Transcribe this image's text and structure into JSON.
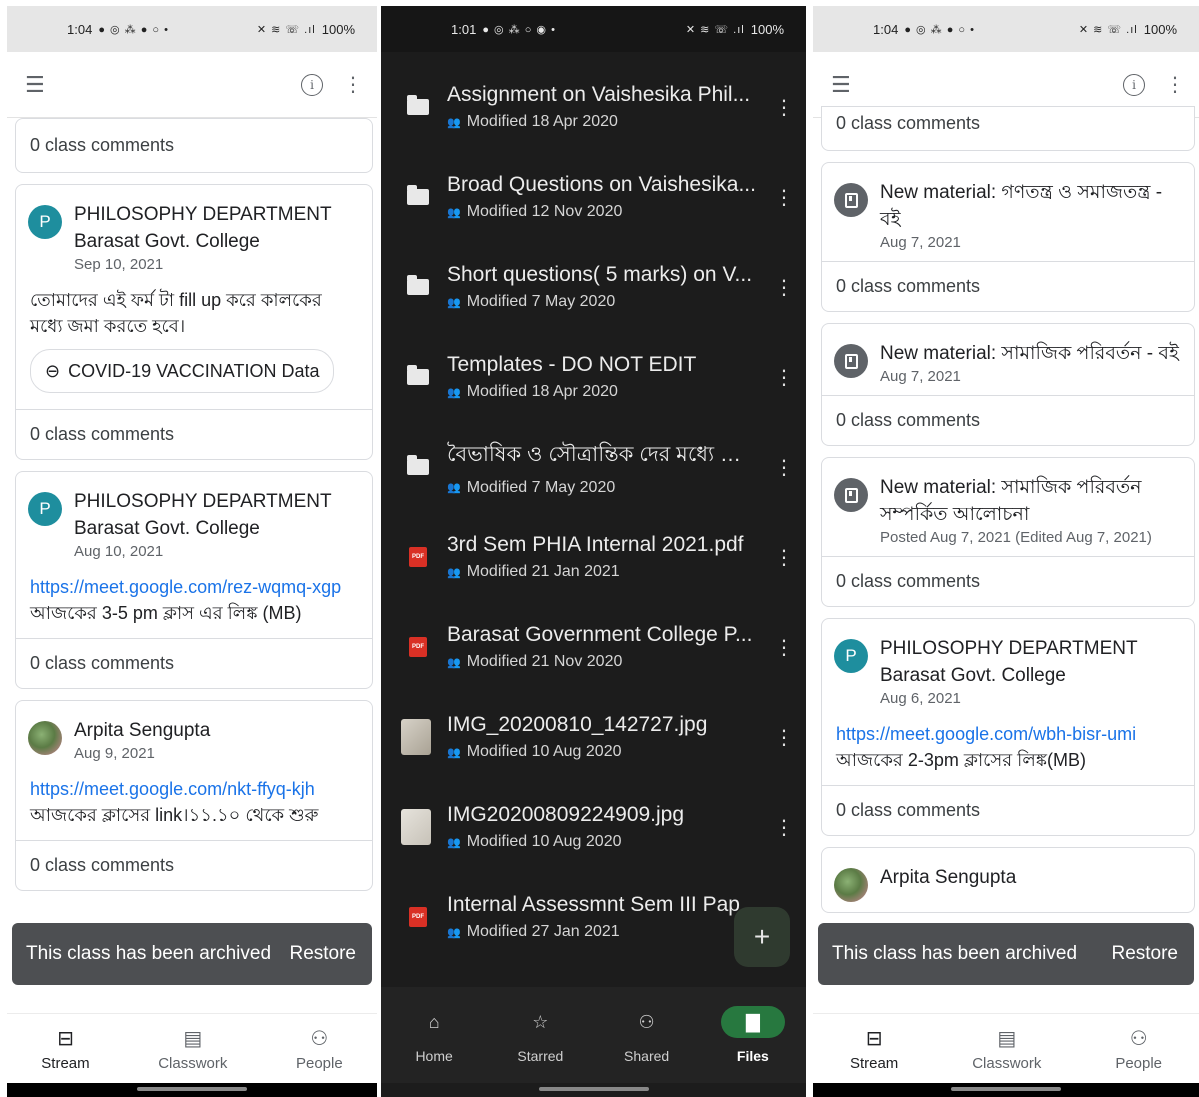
{
  "left": {
    "status": {
      "time": "1:04",
      "left_icons": "● ◎ ⁂ ● ○ •",
      "right_icons": "✕ ≋ ☏ .ıl",
      "battery": "100%"
    },
    "cards": [
      {
        "type": "comments_only",
        "comments": "0 class comments"
      },
      {
        "type": "post",
        "avatar": "P",
        "author": "PHILOSOPHY DEPARTMENT Barasat Govt. College",
        "date": "Sep 10, 2021",
        "text": "তোমাদের এই ফর্ম টা fill up করে কালকের মধ্যে জমা করতে হবে।",
        "chip": "COVID-19 VACCINATION Data",
        "comments": "0 class comments"
      },
      {
        "type": "post",
        "avatar": "P",
        "author": "PHILOSOPHY DEPARTMENT Barasat Govt. College",
        "date": "Aug 10, 2021",
        "link": "https://meet.google.com/rez-wqmq-xgp",
        "text": "আজকের 3-5 pm ক্লাস এর লিঙ্ক (MB)",
        "comments": "0 class comments"
      },
      {
        "type": "post",
        "avatar": "",
        "author": "Arpita Sengupta",
        "date": "Aug 9, 2021",
        "link": "https://meet.google.com/nkt-ffyq-kjh",
        "text": "আজকের ক্লাসের link।১১.১০ থেকে শুরু",
        "comments": "0 class comments"
      }
    ],
    "snackbar": {
      "message": "This class has been archived",
      "action": "Restore"
    },
    "nav": [
      {
        "label": "Stream",
        "icon": "stream-icon",
        "active": true
      },
      {
        "label": "Classwork",
        "icon": "classwork-icon"
      },
      {
        "label": "People",
        "icon": "people-icon"
      }
    ]
  },
  "middle": {
    "status": {
      "time": "1:01",
      "left_icons": "● ◎ ⁂ ○ ◉ •",
      "right_icons": "✕ ≋ ☏ .ıl",
      "battery": "100%"
    },
    "files": [
      {
        "icon": "folder",
        "name": "Assignment on Vaishesika Phil...",
        "modified": "Modified 18 Apr 2020"
      },
      {
        "icon": "folder",
        "name": "Broad Questions on Vaishesika...",
        "modified": "Modified 12 Nov 2020"
      },
      {
        "icon": "folder",
        "name": "Short questions( 5 marks) on V...",
        "modified": "Modified 7 May 2020"
      },
      {
        "icon": "folder",
        "name": "Templates - DO NOT EDIT",
        "modified": "Modified 18 Apr 2020"
      },
      {
        "icon": "folder",
        "name": "বৈভাষিক ও সৌত্রান্তিক দের মধ্যে পা...",
        "modified": "Modified 7 May 2020"
      },
      {
        "icon": "pdf",
        "name": "3rd Sem PHIA Internal 2021.pdf",
        "modified": "Modified 21 Jan 2021"
      },
      {
        "icon": "pdf",
        "name": "Barasat Government College P...",
        "modified": "Modified 21 Nov 2020"
      },
      {
        "icon": "image",
        "name": "IMG_20200810_142727.jpg",
        "modified": "Modified 10 Aug 2020"
      },
      {
        "icon": "image",
        "name": "IMG20200809224909.jpg",
        "modified": "Modified 10 Aug 2020"
      },
      {
        "icon": "pdf",
        "name": "Internal Assessmnt Sem III Pap",
        "modified": "Modified 27 Jan 2021"
      }
    ],
    "fab": "+",
    "nav": [
      {
        "label": "Home",
        "icon": "home-icon"
      },
      {
        "label": "Starred",
        "icon": "star-icon"
      },
      {
        "label": "Shared",
        "icon": "shared-icon"
      },
      {
        "label": "Files",
        "icon": "folder-icon",
        "active": true
      }
    ]
  },
  "right": {
    "status": {
      "time": "1:04",
      "left_icons": "● ◎ ⁂ ● ○ •",
      "right_icons": "✕ ≋ ☏ .ıl",
      "battery": "100%"
    },
    "cards": [
      {
        "type": "comments_only",
        "comments": "0 class comments"
      },
      {
        "type": "material",
        "author": "New material: গণতন্ত্র ও সমাজতন্ত্র - বই",
        "date": "Aug 7, 2021",
        "comments": "0 class comments"
      },
      {
        "type": "material",
        "author": "New material: সামাজিক পরিবর্তন - বই",
        "date": "Aug 7, 2021",
        "comments": "0 class comments"
      },
      {
        "type": "material",
        "author": "New material: সামাজিক পরিবর্তন সম্পর্কিত আলোচনা",
        "date": "Posted Aug 7, 2021 (Edited Aug 7, 2021)",
        "comments": "0 class comments"
      },
      {
        "type": "post",
        "avatar": "P",
        "author": "PHILOSOPHY DEPARTMENT Barasat Govt. College",
        "date": "Aug 6, 2021",
        "link": "https://meet.google.com/wbh-bisr-umi",
        "text": "আজকের 2-3pm ক্লাসের লিঙ্ক(MB)",
        "comments": "0 class comments"
      },
      {
        "type": "post",
        "avatar": "",
        "author": "Arpita Sengupta",
        "date": "",
        "comments": ""
      }
    ],
    "snackbar": {
      "message": "This class has been archived",
      "action": "Restore"
    },
    "nav": [
      {
        "label": "Stream",
        "icon": "stream-icon",
        "active": true
      },
      {
        "label": "Classwork",
        "icon": "classwork-icon"
      },
      {
        "label": "People",
        "icon": "people-icon"
      }
    ]
  }
}
